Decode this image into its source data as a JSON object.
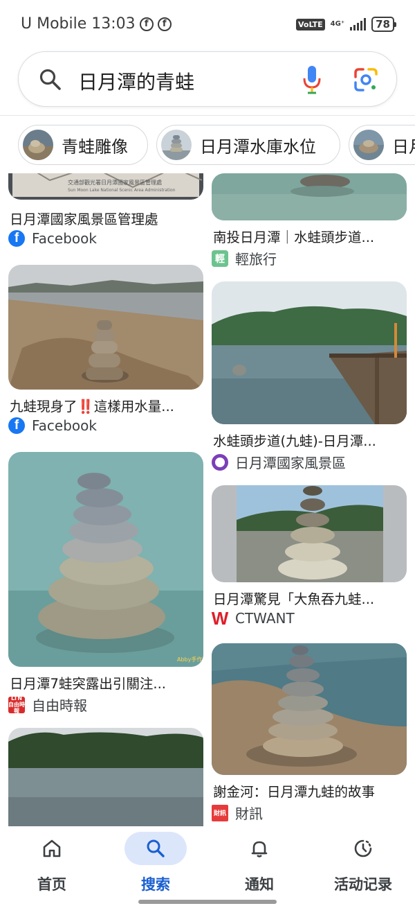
{
  "status_bar": {
    "carrier_time": "U Mobile 13:03",
    "volte": "VoLTE",
    "network": "4G⁺",
    "battery": "78"
  },
  "search": {
    "query": "日月潭的青蛙"
  },
  "chips": [
    {
      "label": "青蛙雕像"
    },
    {
      "label": "日月潭水庫水位"
    },
    {
      "label": "日月"
    }
  ],
  "results": {
    "left": [
      {
        "title": "日月潭國家風景區管理處",
        "source": "Facebook"
      },
      {
        "title": "九蛙現身了‼️這樣用水量...",
        "source": "Facebook"
      },
      {
        "title": "日月潭7蛙突露出引關注...",
        "source": "自由時報",
        "favicon_text": "LTN 自由時報"
      },
      {
        "title": "",
        "source": ""
      }
    ],
    "right": [
      {
        "title": "南投日月潭｜水蛙頭步道...",
        "source": "輕旅行",
        "favicon_text": "輕"
      },
      {
        "title": "水蛙頭步道(九蛙)-日月潭...",
        "source": "日月潭國家風景區"
      },
      {
        "title": "日月潭驚見「大魚吞九蛙...",
        "source": "CTWANT",
        "favicon_text": "W"
      },
      {
        "title": "謝金河：日月潭九蛙的故事",
        "source": "財訊",
        "favicon_text": "財訊"
      }
    ]
  },
  "image_text": {
    "watermark_1": "交通部觀光署日月潭國家風景區管理處",
    "watermark_1_en": "Sun Moon Lake National Scenic Area Administration",
    "watermark_3": "Abby手作"
  },
  "bottom_nav": [
    {
      "label": "首页",
      "icon": "home-icon"
    },
    {
      "label": "搜索",
      "icon": "search-icon",
      "active": true
    },
    {
      "label": "通知",
      "icon": "bell-icon"
    },
    {
      "label": "活动记录",
      "icon": "history-icon"
    }
  ],
  "colors": {
    "accent": "#1a5fd0",
    "active_pill": "#dce6fb",
    "facebook": "#1877f2"
  }
}
